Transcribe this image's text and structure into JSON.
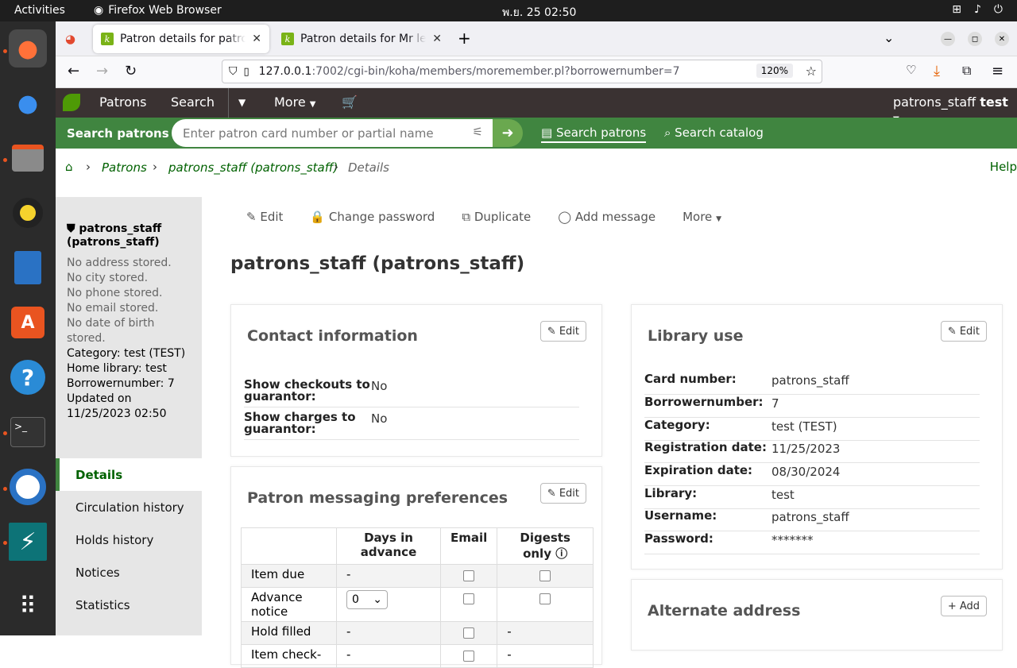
{
  "system": {
    "activities": "Activities",
    "app_name": "Firefox Web Browser",
    "clock": "พ.ย. 25  02:50"
  },
  "browser": {
    "tabs": [
      {
        "title": "Patron details for patrons_staff (patrons_staff)"
      },
      {
        "title": "Patron details for Mr lead"
      }
    ],
    "url_host": "127.0.0.1",
    "url_path": ":7002/cgi-bin/koha/members/moremember.pl?borrowernumber=7",
    "zoom": "120%"
  },
  "koha_nav": {
    "patrons": "Patrons",
    "search": "Search",
    "more": "More",
    "user": "patrons_staff",
    "user_branch": "test"
  },
  "search_bar": {
    "label": "Search patrons",
    "placeholder": "Enter patron card number or partial name",
    "opt_patrons": "Search patrons",
    "opt_catalog": "Search catalog"
  },
  "breadcrumbs": {
    "patrons": "Patrons",
    "patron": "patrons_staff (patrons_staff)",
    "current": "Details",
    "help": "Help"
  },
  "patron_info": {
    "name": "patrons_staff (patrons_staff)",
    "address": "No address stored.",
    "city": "No city stored.",
    "phone": "No phone stored.",
    "email": "No email stored.",
    "dob": "No date of birth stored.",
    "category": "Category: test (TEST)",
    "library": "Home library: test",
    "borrowernumber": "Borrowernumber: 7",
    "updated": "Updated on 11/25/2023 02:50"
  },
  "side_menu": [
    "Details",
    "Circulation history",
    "Holds history",
    "Notices",
    "Statistics"
  ],
  "toolbar": {
    "edit": "Edit",
    "change_password": "Change password",
    "duplicate": "Duplicate",
    "add_message": "Add message",
    "more": "More"
  },
  "page_title": "patrons_staff (patrons_staff)",
  "contact": {
    "title": "Contact information",
    "edit": "Edit",
    "rows": [
      {
        "k": "Show checkouts to guarantor:",
        "v": "No"
      },
      {
        "k": "Show charges to guarantor:",
        "v": "No"
      }
    ]
  },
  "library_use": {
    "title": "Library use",
    "edit": "Edit",
    "rows": [
      {
        "k": "Card number:",
        "v": "patrons_staff"
      },
      {
        "k": "Borrowernumber:",
        "v": "7"
      },
      {
        "k": "Category:",
        "v": "test (TEST)"
      },
      {
        "k": "Registration date:",
        "v": "11/25/2023"
      },
      {
        "k": "Expiration date:",
        "v": "08/30/2024"
      },
      {
        "k": "Library:",
        "v": "test"
      },
      {
        "k": "Username:",
        "v": "patrons_staff"
      },
      {
        "k": "Password:",
        "v": "*******"
      }
    ]
  },
  "messaging": {
    "title": "Patron messaging preferences",
    "edit": "Edit",
    "col_days": "Days in advance",
    "col_email": "Email",
    "col_digests": "Digests only",
    "rows": [
      {
        "name": "Item due",
        "days": "-",
        "digests": ""
      },
      {
        "name": "Advance notice",
        "days": "0",
        "digests": ""
      },
      {
        "name": "Hold filled",
        "days": "-",
        "digests": "-"
      },
      {
        "name": "Item check-",
        "days": "-",
        "digests": "-"
      }
    ]
  },
  "alternate": {
    "title": "Alternate address",
    "add": "Add"
  }
}
